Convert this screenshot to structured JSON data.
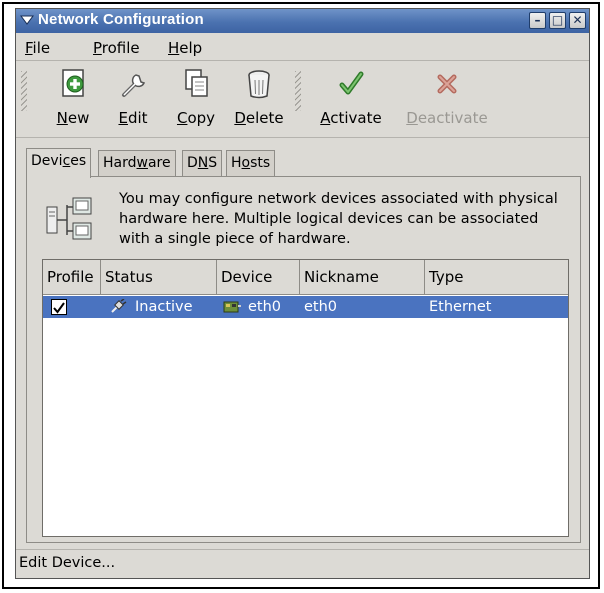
{
  "window": {
    "title": "Network Configuration",
    "minimize": "–",
    "maximize": "□",
    "close": "✕"
  },
  "menubar": {
    "items": [
      {
        "pre": "",
        "u": "F",
        "post": "ile"
      },
      {
        "pre": "",
        "u": "P",
        "post": "rofile"
      },
      {
        "pre": "",
        "u": "H",
        "post": "elp"
      }
    ]
  },
  "toolbar": {
    "items": [
      {
        "pre": "",
        "u": "N",
        "post": "ew",
        "icon": "new-icon",
        "enabled": true
      },
      {
        "pre": "",
        "u": "E",
        "post": "dit",
        "icon": "edit-icon",
        "enabled": true
      },
      {
        "pre": "",
        "u": "C",
        "post": "opy",
        "icon": "copy-icon",
        "enabled": true
      },
      {
        "pre": "",
        "u": "D",
        "post": "elete",
        "icon": "delete-icon",
        "enabled": true
      },
      {
        "pre": "",
        "u": "A",
        "post": "ctivate",
        "icon": "activate-icon",
        "enabled": true
      },
      {
        "pre": "",
        "u": "D",
        "post": "eactivate",
        "icon": "deactivate-icon",
        "enabled": false
      }
    ]
  },
  "tabs": [
    {
      "pre": "Devi",
      "u": "c",
      "post": "es",
      "active": true
    },
    {
      "pre": "Hard",
      "u": "w",
      "post": "are",
      "active": false
    },
    {
      "pre": "D",
      "u": "N",
      "post": "S",
      "active": false
    },
    {
      "pre": "H",
      "u": "o",
      "post": "sts",
      "active": false
    }
  ],
  "devices_tab": {
    "description": "You may configure network devices associated with physical hardware here.  Multiple logical devices can be associated with a single piece of hardware.",
    "columns": [
      "Profile",
      "Status",
      "Device",
      "Nickname",
      "Type"
    ],
    "rows": [
      {
        "profile_checked": true,
        "profile_mark": "✓",
        "status": "Inactive",
        "device": "eth0",
        "nickname": "eth0",
        "type": "Ethernet",
        "selected": true
      }
    ]
  },
  "statusbar": {
    "text": "Edit Device..."
  },
  "colors": {
    "titlebar": "#4b72b0",
    "selection": "#4a73c0",
    "window_bg": "#dcdad5"
  }
}
